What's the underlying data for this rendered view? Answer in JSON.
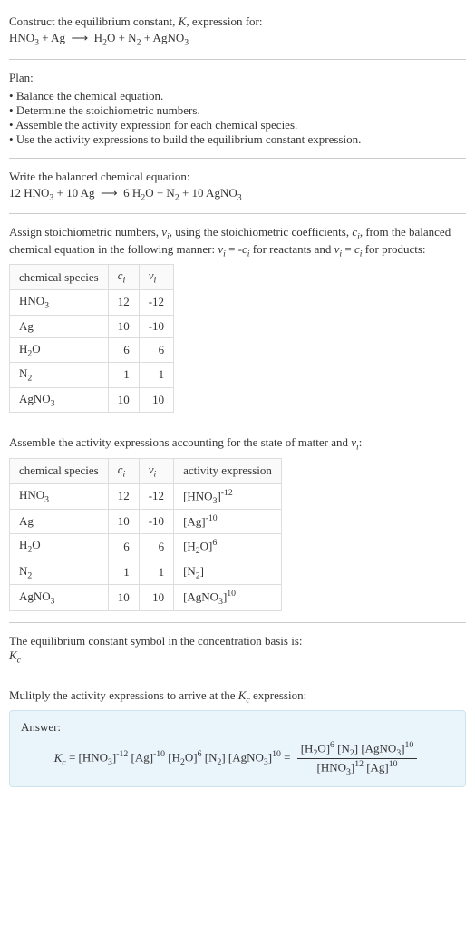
{
  "header": {
    "prompt": "Construct the equilibrium constant, K, expression for:",
    "equation": "HNO₃ + Ag ⟶ H₂O + N₂ + AgNO₃"
  },
  "plan": {
    "title": "Plan:",
    "items": [
      "Balance the chemical equation.",
      "Determine the stoichiometric numbers.",
      "Assemble the activity expression for each chemical species.",
      "Use the activity expressions to build the equilibrium constant expression."
    ]
  },
  "balanced": {
    "intro": "Write the balanced chemical equation:",
    "equation": "12 HNO₃ + 10 Ag ⟶ 6 H₂O + N₂ + 10 AgNO₃"
  },
  "stoich": {
    "intro": "Assign stoichiometric numbers, νᵢ, using the stoichiometric coefficients, cᵢ, from the balanced chemical equation in the following manner: νᵢ = -cᵢ for reactants and νᵢ = cᵢ for products:",
    "cols": {
      "species": "chemical species",
      "ci": "cᵢ",
      "vi": "νᵢ"
    },
    "rows": [
      {
        "species": "HNO₃",
        "ci": "12",
        "vi": "-12"
      },
      {
        "species": "Ag",
        "ci": "10",
        "vi": "-10"
      },
      {
        "species": "H₂O",
        "ci": "6",
        "vi": "6"
      },
      {
        "species": "N₂",
        "ci": "1",
        "vi": "1"
      },
      {
        "species": "AgNO₃",
        "ci": "10",
        "vi": "10"
      }
    ]
  },
  "activity": {
    "intro": "Assemble the activity expressions accounting for the state of matter and νᵢ:",
    "cols": {
      "species": "chemical species",
      "ci": "cᵢ",
      "vi": "νᵢ",
      "expr": "activity expression"
    },
    "rows": [
      {
        "species": "HNO₃",
        "ci": "12",
        "vi": "-12",
        "expr": "[HNO₃]⁻¹²"
      },
      {
        "species": "Ag",
        "ci": "10",
        "vi": "-10",
        "expr": "[Ag]⁻¹⁰"
      },
      {
        "species": "H₂O",
        "ci": "6",
        "vi": "6",
        "expr": "[H₂O]⁶"
      },
      {
        "species": "N₂",
        "ci": "1",
        "vi": "1",
        "expr": "[N₂]"
      },
      {
        "species": "AgNO₃",
        "ci": "10",
        "vi": "10",
        "expr": "[AgNO₃]¹⁰"
      }
    ]
  },
  "symbol": {
    "intro": "The equilibrium constant symbol in the concentration basis is:",
    "kc": "K꜀"
  },
  "result": {
    "intro": "Mulitply the activity expressions to arrive at the K꜀ expression:",
    "answer_label": "Answer:",
    "lhs": "K꜀ = [HNO₃]⁻¹² [Ag]⁻¹⁰ [H₂O]⁶ [N₂] [AgNO₃]¹⁰ = ",
    "frac_num": "[H₂O]⁶ [N₂] [AgNO₃]¹⁰",
    "frac_den": "[HNO₃]¹² [Ag]¹⁰"
  }
}
